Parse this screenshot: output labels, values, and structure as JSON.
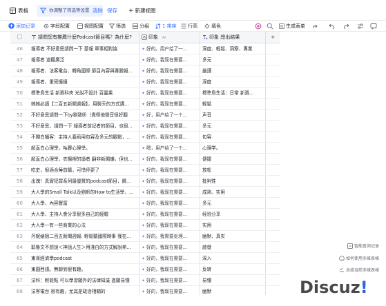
{
  "titlebar": {
    "table_label": "表格",
    "filter_text": "你调整了筛选等设置",
    "clear_label": "清除",
    "save_label": "保存",
    "new_view_label": "新建视图"
  },
  "toolbar": {
    "add_record": "添加记录",
    "field_config": "字段配置",
    "view_config": "视图配置",
    "filter": "筛选",
    "group": "分组",
    "sort": "1 排序",
    "row_height": "行高",
    "fill_color": "填色",
    "generate_form": "生成表单"
  },
  "columns": {
    "a": "請問您有推薦什麼Podcast節目嗎？為什麼?",
    "b": "印象",
    "b_mark": "AI",
    "c": "印象 總出結果"
  },
  "rows": [
    {
      "n": "46",
      "a": "報導者 不好意思請問一下 蔓報 軍事相對論",
      "b": "好的。用户给了一...",
      "c": "深度、輕鬆、洞察、專業"
    },
    {
      "n": "47",
      "a": "報導者 道聽廣泛",
      "b": "好的，我现在需要...",
      "c": "多元"
    },
    {
      "n": "48",
      "a": "報導者、法客電台、轉角國際 節目內容與專題報...",
      "b": "好的，我现在需要...",
      "c": "嚴謹"
    },
    {
      "n": "49",
      "a": "報導者，重磅撞撞",
      "b": "好的，我现在需要...",
      "c": "深度"
    },
    {
      "n": "50",
      "a": "標準鳥生活 新資科夾 光說不設計 百靈果",
      "b": "好的，我现在需要...",
      "c": "標準鳥生活：日常 新資..."
    },
    {
      "n": "51",
      "a": "姊姊必讀【二百五新聞週報】，用聊天的方式講...",
      "b": "好的，我现在需要...",
      "c": "輕鬆"
    },
    {
      "n": "52",
      "a": "不好意思請問一下by劉致昕（覺得他聲音很好聽",
      "b": "好，用户给了一个...",
      "c": "声音"
    },
    {
      "n": "53",
      "a": "不好意思，請問一下 報導者前記者的節目，也很...",
      "b": "好的，我现在需要...",
      "c": "多元"
    },
    {
      "n": "54",
      "a": "不開白播客：主持人義莉用包容及多元的觀點，...",
      "b": "好的，我现在需要...",
      "c": "包容"
    },
    {
      "n": "55",
      "a": "超直白心理學，咕賽心理學。",
      "b": "嗯，用户给了一个...",
      "c": "心理学。"
    },
    {
      "n": "56",
      "a": "超直白心理學，衣櫥裡的讀者 翻非新聞嫌，但也...",
      "b": "好的，我现在需要...",
      "c": "便捷"
    },
    {
      "n": "57",
      "a": "吃史，很適合睡前聽，可惜停更了",
      "b": "好的，我现在需要...",
      "c": "放松"
    },
    {
      "n": "58",
      "a": "出瑰！真實犯罪系列最優質的podcast節目，饒...",
      "b": "好的，我现在需要...",
      "c": "批判性"
    },
    {
      "n": "59",
      "a": "大人學的Small Talk以及劉軒的How to生活學，...",
      "b": "好的，我现在需要...",
      "c": "成熟、实用"
    },
    {
      "n": "60",
      "a": "大人學，內容豐富",
      "b": "好的，我现在需要...",
      "c": "多元"
    },
    {
      "n": "61",
      "a": "大人學，主持人會分享很多自己的經驗",
      "b": "好的，我现在需要...",
      "c": "经验分享"
    },
    {
      "n": "62",
      "a": "大人學一有一些商業的心法",
      "b": "好的，我现在需要...",
      "c": "实用"
    },
    {
      "n": "63",
      "a": "丹妮婊姐二百五新聞週報: 輕鬆聽國際時事 我在...",
      "b": "好的。我需要处理...",
      "c": "幽默、真实"
    },
    {
      "n": "64",
      "a": "耶魯文不想說＜神話人生＞用淺白的方式解說希...",
      "b": "好的，我现在需要...",
      "c": "啟發"
    },
    {
      "n": "65",
      "a": "東哥經濟學podcast",
      "b": "好的，我现在需要...",
      "c": "深入"
    },
    {
      "n": "66",
      "a": "東園西謹。無聊到很有趣。",
      "b": "好的，我现在需要...",
      "c": "反转"
    },
    {
      "n": "67",
      "a": "法科：輕鬆點 可以學習願外的法律知識 進願易懂",
      "b": "好的，我现在需要...",
      "c": "易懂"
    },
    {
      "n": "68",
      "a": "法客電台 很有趣，尤其是政治相關的",
      "b": "好的，我现在需要...",
      "c": "幽默"
    }
  ],
  "side": {
    "ask": "智能查询记录",
    "howto": "如何使用多维表格",
    "summary": "总结当前多维表格"
  },
  "logo": {
    "text": "Discuz",
    "bang": "!"
  }
}
